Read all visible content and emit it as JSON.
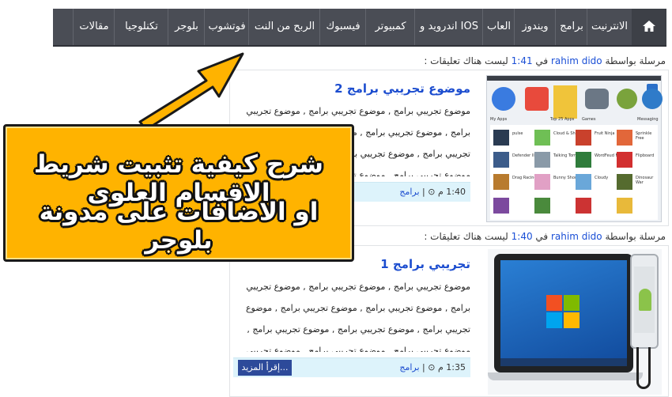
{
  "nav": {
    "items": [
      "الانترنيت",
      "برامج",
      "ويندوز",
      "العاب",
      "اندرويد و IOS",
      "كمبيوتر",
      "فيسبوك",
      "الربح من النت",
      "فوتشوب",
      "بلوجر",
      "تكنلوجيا",
      "مقالات"
    ],
    "home_icon": "home-icon"
  },
  "posts": [
    {
      "meta_prefix": "مرسلة بواسطة",
      "author": "rahim dido",
      "meta_in": "في",
      "time": "1:41",
      "comments": "ليست هناك تعليقات :",
      "title": "موضوع تجريبي برامج 2",
      "excerpt": "موضوع تجريبي برامج , موضوع تجريبي برامج , موضوع تجريبي برامج , موضوع تجريبي برامج , موضوع تجريبي برامج , موضوع تجريبي برامج , موضوع تجريبي برامج , موضوع تجريبي برامج , موضوع تجريبي برامج , موضوع تجريبي برامج , موضوع تجريبي برامج , موضوع تجريبي برامج , موضوع تج",
      "foot_time": "1:40 م",
      "foot_category": "برامج",
      "read_more": ""
    },
    {
      "meta_prefix": "مرسلة بواسطة",
      "author": "rahim dido",
      "meta_in": "في",
      "time": "1:40",
      "comments": "ليست هناك تعليقات :",
      "title": "تجريبي برامج 1",
      "excerpt": "موضوع تجريبي برامج , موضوع تجريبي برامج , موضوع تجريبي برامج , موضوع تجريبي برامج , موضوع تجريبي برامج , موضوع تجريبي برامج , موضوع تجريبي برامج , موضوع تجريبي برامج , موضوع تجريبي برامج , موضوع تجريبي برامج , موضوع تجريبي برامج , موضوع تجريبي برامج , موضوع تج",
      "foot_time": "1:35 م",
      "foot_category": "برامج",
      "read_more": "إقرأ المزيد..."
    }
  ],
  "banner": {
    "line1": "شرح كيفية تثبيت شريط الاقسام العلوى",
    "line2": "او الاضافات على مدونة بلوجر"
  },
  "thumb1": {
    "store_labels": [
      "My Apps",
      "Top 25 Apps",
      "Games",
      "Messaging"
    ],
    "app_names": [
      "pulse",
      "Cloud & Sheep",
      "Fruit Ninja",
      "Sprinkle Free",
      "Defender II",
      "Talking Tom 2",
      "WordFeud FREE",
      "Flipboard",
      "Drag Racing",
      "Bunny Shooter",
      "Cloudy",
      "Dinosaur War"
    ]
  },
  "colors": {
    "nav_bg": "#4a4d55",
    "link": "#1c4dcf",
    "banner": "#ffb300",
    "arrow": "#ffb300",
    "foot_bg": "#ddf3fb",
    "read_more_bg": "#2d4a9a"
  }
}
